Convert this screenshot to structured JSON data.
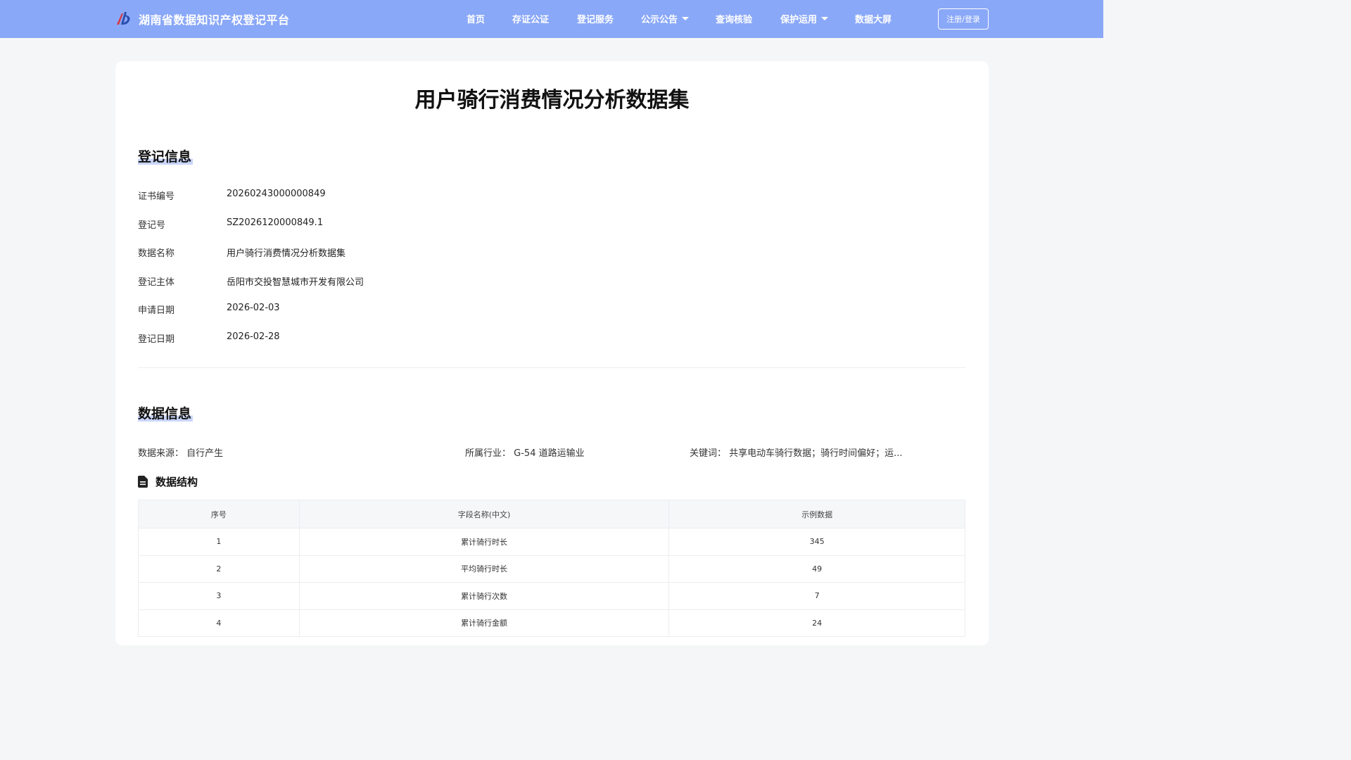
{
  "header": {
    "brand": "湖南省数据知识产权登记平台",
    "logo_icon": "brand-logo-icon",
    "bg_color": "#8aa8f8",
    "nav": [
      {
        "label": "首页",
        "dropdown": false
      },
      {
        "label": "存证公证",
        "dropdown": false
      },
      {
        "label": "登记服务",
        "dropdown": false
      },
      {
        "label": "公示公告",
        "dropdown": true
      },
      {
        "label": "查询核验",
        "dropdown": false
      },
      {
        "label": "保护运用",
        "dropdown": true
      },
      {
        "label": "数据大屏",
        "dropdown": false
      }
    ],
    "login_label": "注册/登录"
  },
  "page": {
    "title": "用户骑行消费情况分析数据集"
  },
  "registration": {
    "section_title": "登记信息",
    "rows": [
      {
        "label": "证书编号",
        "value": "20260243000000849"
      },
      {
        "label": "登记号",
        "value": "SZ2026120000849.1"
      },
      {
        "label": "数据名称",
        "value": "用户骑行消费情况分析数据集"
      },
      {
        "label": "登记主体",
        "value": "岳阳市交投智慧城市开发有限公司"
      },
      {
        "label": "申请日期",
        "value": "2026-02-03"
      },
      {
        "label": "登记日期",
        "value": "2026-02-28"
      }
    ]
  },
  "data_info": {
    "section_title": "数据信息",
    "source_label": "数据来源：",
    "source_value": "自行产生",
    "industry_label": "所属行业：",
    "industry_value": "G-54 道路运输业",
    "keywords_label": "关键词：",
    "keywords_value": "共享电动车骑行数据；骑行时间偏好；运...",
    "structure_title": "数据结构",
    "structure_icon": "document-icon",
    "table": {
      "headers": [
        "序号",
        "字段名称(中文)",
        "示例数据"
      ],
      "rows": [
        [
          "1",
          "累计骑行时长",
          "345"
        ],
        [
          "2",
          "平均骑行时长",
          "49"
        ],
        [
          "3",
          "累计骑行次数",
          "7"
        ],
        [
          "4",
          "累计骑行金额",
          "24"
        ]
      ]
    }
  }
}
